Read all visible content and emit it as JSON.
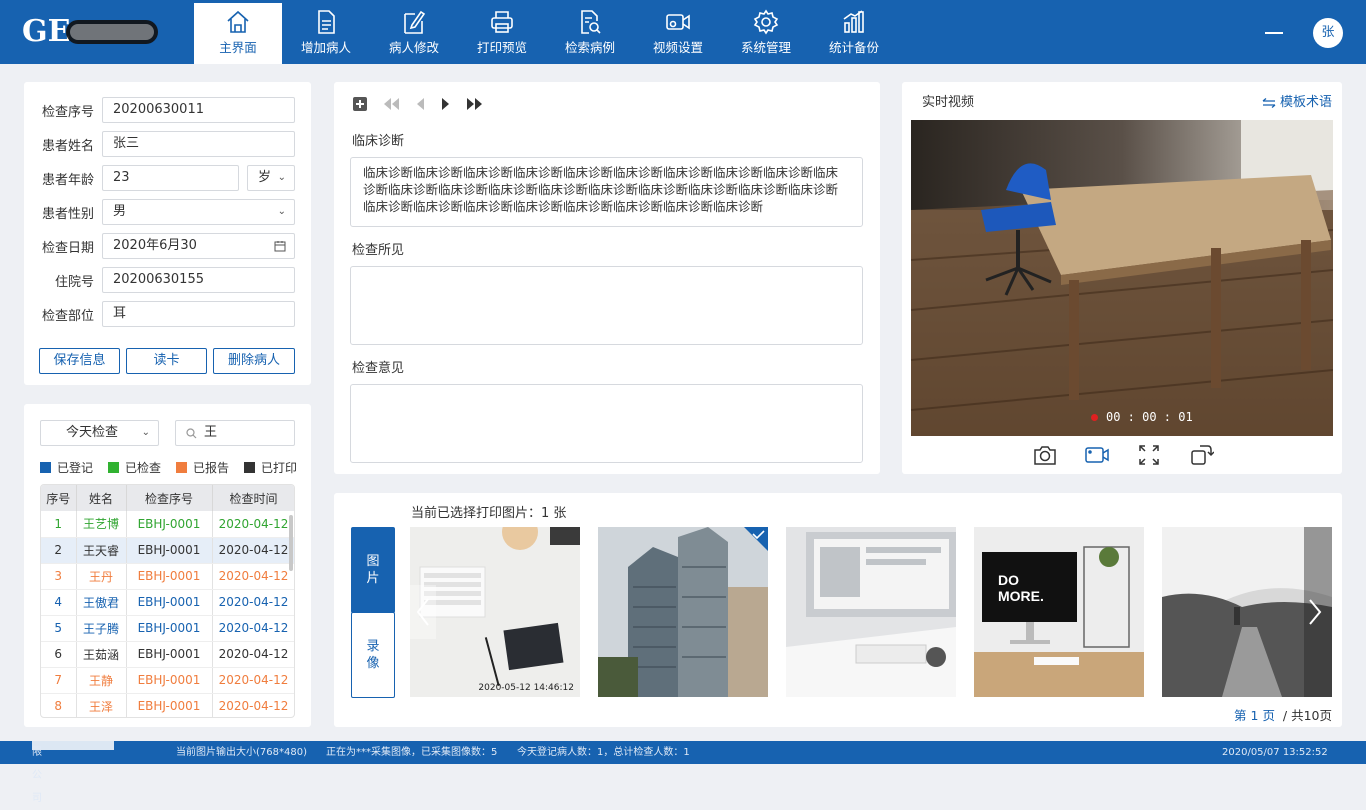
{
  "nav": {
    "items": [
      {
        "label": "主界面",
        "icon": "home-icon"
      },
      {
        "label": "增加病人",
        "icon": "add-patient-icon"
      },
      {
        "label": "病人修改",
        "icon": "edit-patient-icon"
      },
      {
        "label": "打印预览",
        "icon": "print-icon"
      },
      {
        "label": "检索病例",
        "icon": "search-case-icon"
      },
      {
        "label": "视频设置",
        "icon": "video-settings-icon"
      },
      {
        "label": "系统管理",
        "icon": "gear-icon"
      },
      {
        "label": "统计备份",
        "icon": "statistics-icon"
      }
    ],
    "active_index": 0,
    "avatar": "张"
  },
  "patient": {
    "exam_no_label": "检查序号",
    "exam_no": "20200630011",
    "name_label": "患者姓名",
    "name": "张三",
    "age_label": "患者年龄",
    "age": "23",
    "age_unit": "岁",
    "gender_label": "患者性别",
    "gender": "男",
    "date_label": "检查日期",
    "date": "2020年6月30",
    "inpatient_label": "住院号",
    "inpatient": "20200630155",
    "part_label": "检查部位",
    "part": "耳",
    "save_btn": "保存信息",
    "read_btn": "读卡",
    "delete_btn": "删除病人"
  },
  "list": {
    "filter": "今天检查",
    "search_value": "王",
    "legend": [
      {
        "label": "已登记",
        "color": "#1762b0"
      },
      {
        "label": "已检查",
        "color": "#31b231"
      },
      {
        "label": "已报告",
        "color": "#f07d3e"
      },
      {
        "label": "已打印",
        "color": "#333333"
      }
    ],
    "headers": [
      "序号",
      "姓名",
      "检查序号",
      "检查时间"
    ],
    "rows": [
      {
        "cells": [
          "1",
          "王艺博",
          "EBHJ-0001",
          "2020-04-12"
        ],
        "status": "green"
      },
      {
        "cells": [
          "2",
          "王天睿",
          "EBHJ-0001",
          "2020-04-12"
        ],
        "status": "dark"
      },
      {
        "cells": [
          "3",
          "王丹",
          "EBHJ-0001",
          "2020-04-12"
        ],
        "status": "orange"
      },
      {
        "cells": [
          "4",
          "王傲君",
          "EBHJ-0001",
          "2020-04-12"
        ],
        "status": "blue"
      },
      {
        "cells": [
          "5",
          "王子腾",
          "EBHJ-0001",
          "2020-04-12"
        ],
        "status": "blue"
      },
      {
        "cells": [
          "6",
          "王茹涵",
          "EBHJ-0001",
          "2020-04-12"
        ],
        "status": "dark"
      },
      {
        "cells": [
          "7",
          "王静",
          "EBHJ-0001",
          "2020-04-12"
        ],
        "status": "orange"
      },
      {
        "cells": [
          "8",
          "王泽",
          "EBHJ-0001",
          "2020-04-12"
        ],
        "status": "orange"
      }
    ]
  },
  "report": {
    "diagnosis_label": "临床诊断",
    "diagnosis_text": "临床诊断临床诊断临床诊断临床诊断临床诊断临床诊断临床诊断临床诊断临床诊断临床诊断临床诊断临床诊断临床诊断临床诊断临床诊断临床诊断临床诊断临床诊断临床诊断临床诊断临床诊断临床诊断临床诊断临床诊断临床诊断临床诊断临床诊断",
    "findings_label": "检查所见",
    "findings_text": "",
    "opinion_label": "检查意见",
    "opinion_text": ""
  },
  "video": {
    "title": "实时视频",
    "template_link": "模板术语",
    "timer": "00 : 00 : 01"
  },
  "gallery": {
    "selected_info": "当前已选择打印图片：1 张",
    "tab_images": "图\n片",
    "tab_recordings": "录\n像",
    "first_timestamp": "2020-05-12  14:46:12",
    "page_current": "第 1 页",
    "page_total": "/ 共10页"
  },
  "status": {
    "company": "限公司",
    "output_size": "当前图片输出大小(768*480)",
    "capturing": "正在为***采集图像，已采集图像数：5",
    "today_count": "今天登记病人数：1，总计检查人数：1",
    "datetime": "2020/05/07   13:52:52"
  }
}
